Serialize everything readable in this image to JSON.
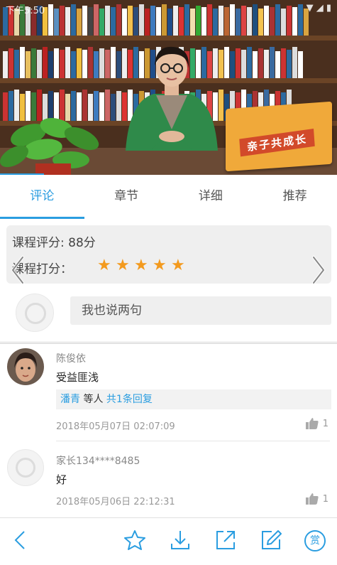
{
  "status_bar": {
    "time": "下午5:50",
    "right": "▼ ◢ ▮"
  },
  "video": {
    "card_title": "亲子共成长",
    "progress_percent": 13
  },
  "tabs": [
    {
      "label": "评论",
      "active": true
    },
    {
      "label": "章节",
      "active": false
    },
    {
      "label": "详细",
      "active": false
    },
    {
      "label": "推荐",
      "active": false
    }
  ],
  "rating": {
    "course_score_label": "课程评分: 88分",
    "my_score_label": "课程打分：",
    "stars": 5
  },
  "comment_input": {
    "placeholder": "我也说两句"
  },
  "comments": [
    {
      "author": "陈俊依",
      "text": "受益匪浅",
      "reply_user": "潘青",
      "reply_mid": "等人",
      "reply_count": "共1条回复",
      "time": "2018年05月07日 02:07:09",
      "likes": "1"
    },
    {
      "author": "家长134****8485",
      "text": "好",
      "time": "2018年05月06日 22:12:31",
      "likes": "1"
    }
  ],
  "bottom_bar": {
    "reward_label": "赏"
  },
  "colors": {
    "accent": "#2a9de0",
    "star": "#f39a1e"
  }
}
